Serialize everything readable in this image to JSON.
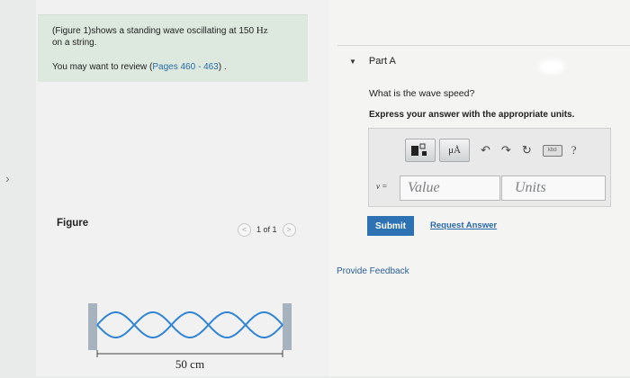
{
  "problem": {
    "intro_prefix": "(Figure 1)shows a standing wave oscillating at 150 ",
    "intro_unit": "Hz",
    "intro_suffix": "on a string.",
    "review_prefix": "You may want to review (",
    "review_pages": "Pages 460 - 463",
    "review_suffix": ") ."
  },
  "figure": {
    "label": "Figure",
    "pager": {
      "prev": "<",
      "count": "1 of 1",
      "next": ">"
    },
    "length_label": "50 cm"
  },
  "part": {
    "title": "Part A",
    "question": "What is the wave speed?",
    "instruction": "Express your answer with the appropriate units.",
    "variable": "v =",
    "value_placeholder": "Value",
    "units_placeholder": "Units",
    "units_tool_label": "μÅ",
    "help_label": "?",
    "keyboard_label": "kbd"
  },
  "actions": {
    "submit": "Submit",
    "request_answer": "Request Answer",
    "provide_feedback": "Provide Feedback"
  },
  "colors": {
    "submit": "#2d73b3",
    "link": "#2868a8",
    "intro_bg": "#dde9df",
    "wave": "#2f84d6"
  }
}
